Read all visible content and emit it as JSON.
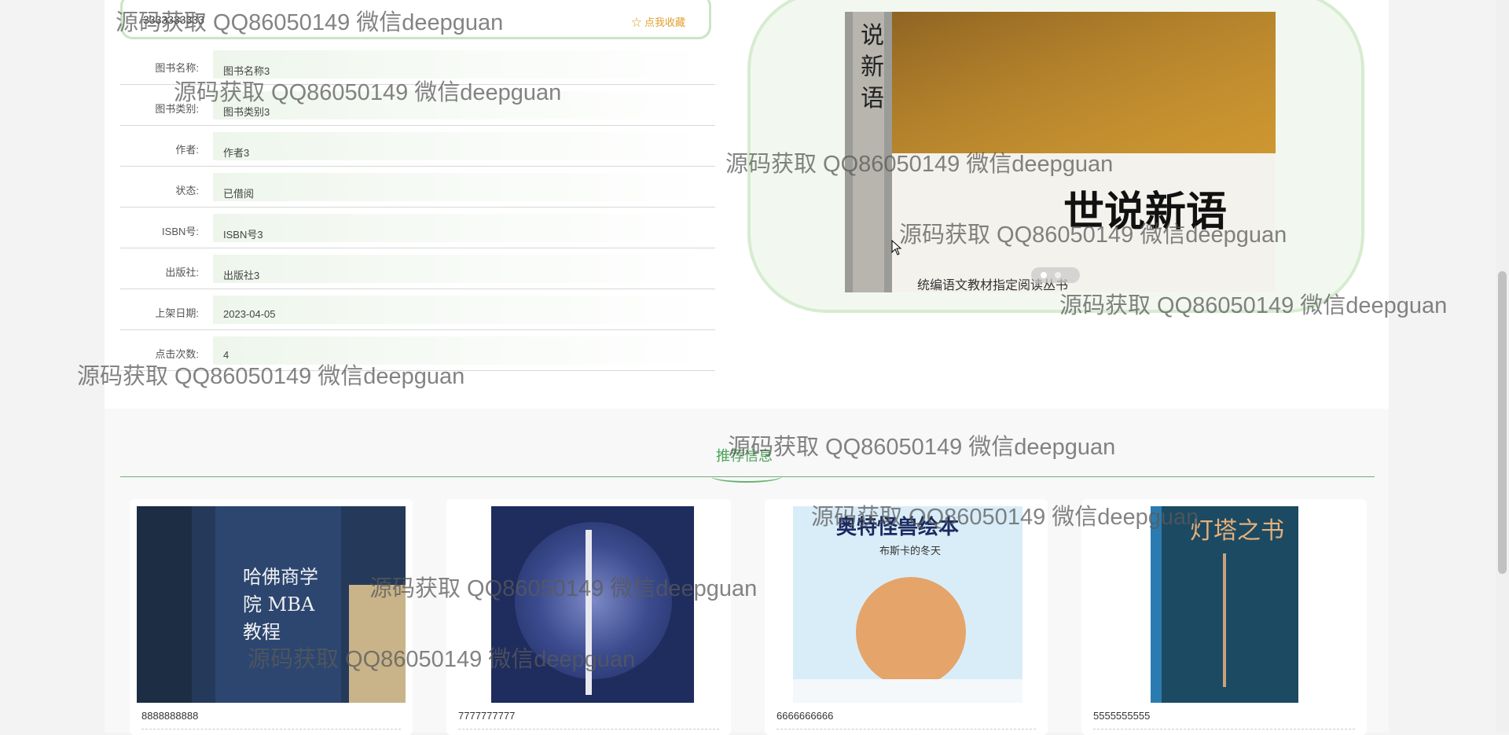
{
  "book": {
    "title": "3333333333",
    "favorite_label": "☆ 点我收藏",
    "details": [
      {
        "label": "图书名称:",
        "value": "图书名称3"
      },
      {
        "label": "图书类别:",
        "value": "图书类别3"
      },
      {
        "label": "作者:",
        "value": "作者3"
      },
      {
        "label": "状态:",
        "value": "已借阅"
      },
      {
        "label": "ISBN号:",
        "value": "ISBN号3"
      },
      {
        "label": "出版社:",
        "value": "出版社3"
      },
      {
        "label": "上架日期:",
        "value": "2023-04-05"
      },
      {
        "label": "点击次数:",
        "value": "4"
      }
    ],
    "cover_text": "世说新语",
    "cover_tagline": "统编语文教材指定阅读丛书"
  },
  "recommend": {
    "heading": "推荐信息",
    "items": [
      {
        "title": "8888888888",
        "cover_text": "哈佛商学院 MBA教程"
      },
      {
        "title": "7777777777",
        "cover_text": ""
      },
      {
        "title": "6666666666",
        "cover_text": "奥特怪兽绘本",
        "cover_subtext": "布斯卡的冬天"
      },
      {
        "title": "5555555555",
        "cover_text": "灯塔之书"
      }
    ]
  },
  "watermark": "源码获取 QQ86050149 微信deepguan"
}
